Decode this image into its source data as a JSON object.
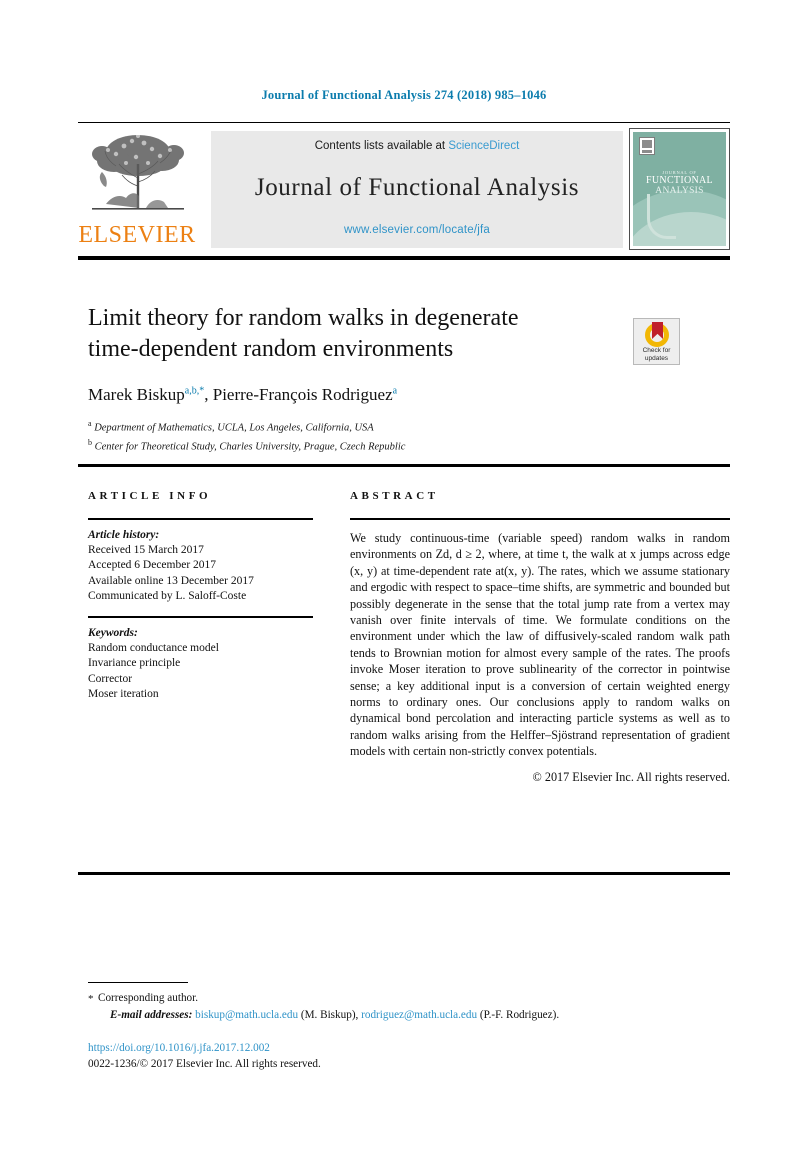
{
  "running_head": "Journal of Functional Analysis 274 (2018) 985–1046",
  "masthead": {
    "contents_prefix": "Contents lists available at ",
    "sciencedirect": "ScienceDirect",
    "journal_title": "Journal of Functional Analysis",
    "journal_url": "www.elsevier.com/locate/jfa",
    "publisher_wordmark": "ELSEVIER",
    "cover": {
      "line1": "JOURNAL OF",
      "line2": "FUNCTIONAL",
      "line3": "ANALYSIS"
    }
  },
  "article": {
    "title_line1": "Limit theory for random walks in degenerate",
    "title_line2": "time-dependent random environments",
    "authors": "Marek Biskup",
    "author1_sup": "a,b,*",
    "authors_mid": ", Pierre-François Rodriguez",
    "author2_sup": "a",
    "affiliation_a_mark": "a",
    "affiliation_a": " Department of Mathematics, UCLA, Los Angeles, California, USA",
    "affiliation_b_mark": "b",
    "affiliation_b": " Center for Theoretical Study, Charles University, Prague, Czech Republic"
  },
  "crossmark": {
    "label_line1": "Check for",
    "label_line2": "updates"
  },
  "info": {
    "heading": "ARTICLE INFO",
    "history_label": "Article history:",
    "history": [
      "Received 15 March 2017",
      "Accepted 6 December 2017",
      "Available online 13 December 2017",
      "Communicated by L. Saloff-Coste"
    ],
    "keywords_label": "Keywords:",
    "keywords": [
      "Random conductance model",
      "Invariance principle",
      "Corrector",
      "Moser iteration"
    ]
  },
  "abstract": {
    "heading": "ABSTRACT",
    "body": "We study continuous-time (variable speed) random walks in random environments on Zd, d ≥ 2, where, at time t, the walk at x jumps across edge (x, y) at time-dependent rate at(x, y). The rates, which we assume stationary and ergodic with respect to space–time shifts, are symmetric and bounded but possibly degenerate in the sense that the total jump rate from a vertex may vanish over finite intervals of time. We formulate conditions on the environment under which the law of diffusively-scaled random walk path tends to Brownian motion for almost every sample of the rates. The proofs invoke Moser iteration to prove sublinearity of the corrector in pointwise sense; a key additional input is a conversion of certain weighted energy norms to ordinary ones. Our conclusions apply to random walks on dynamical bond percolation and interacting particle systems as well as to random walks arising from the Helffer–Sjöstrand representation of gradient models with certain non-strictly convex potentials.",
    "copyright": "© 2017 Elsevier Inc. All rights reserved."
  },
  "footnotes": {
    "star": "*",
    "corresponding": "Corresponding author.",
    "email_label": "E-mail addresses:",
    "email1": "biskup@math.ucla.edu",
    "email1_name": " (M. Biskup), ",
    "email2": "rodriguez@math.ucla.edu",
    "email2_name": " (P.-F. Rodriguez)."
  },
  "doi_block": {
    "doi": "https://doi.org/10.1016/j.jfa.2017.12.002",
    "issn_line": "0022-1236/© 2017 Elsevier Inc. All rights reserved."
  },
  "colors": {
    "link_blue": "#2f93c8",
    "header_blue": "#0b7cad",
    "elsevier_orange": "#ec8013",
    "cover_teal": "#7fb0a2",
    "crossmark_gold": "#f2b705",
    "crossmark_red": "#c0202a"
  }
}
